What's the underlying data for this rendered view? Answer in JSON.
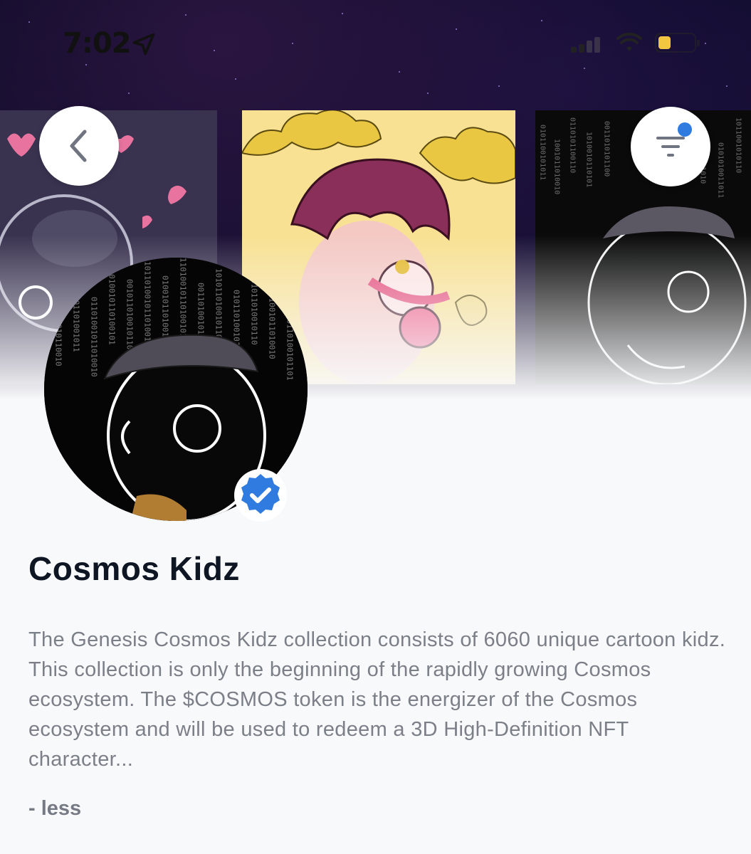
{
  "status_bar": {
    "time": "7:02",
    "icons": [
      "location-arrow-icon",
      "cellular-signal-icon",
      "wifi-icon",
      "battery-icon"
    ],
    "battery_color": "#f2c641",
    "battery_level": 0.3
  },
  "header": {
    "back_icon": "chevron-left-icon",
    "filter_icon": "filter-icon",
    "filter_dot_color": "#2f7be0"
  },
  "collection": {
    "name": "Cosmos Kidz",
    "verified": true,
    "verified_color": "#2f7be0",
    "description": "The Genesis Cosmos Kidz collection consists of 6060 unique cartoon kidz. This collection is only the beginning of the rapidly growing Cosmos ecosystem. The $COSMOS token is the energizer of the Cosmos ecosystem and will be used to redeem a 3D High-Definition NFT character...",
    "toggle_label": "- less"
  }
}
